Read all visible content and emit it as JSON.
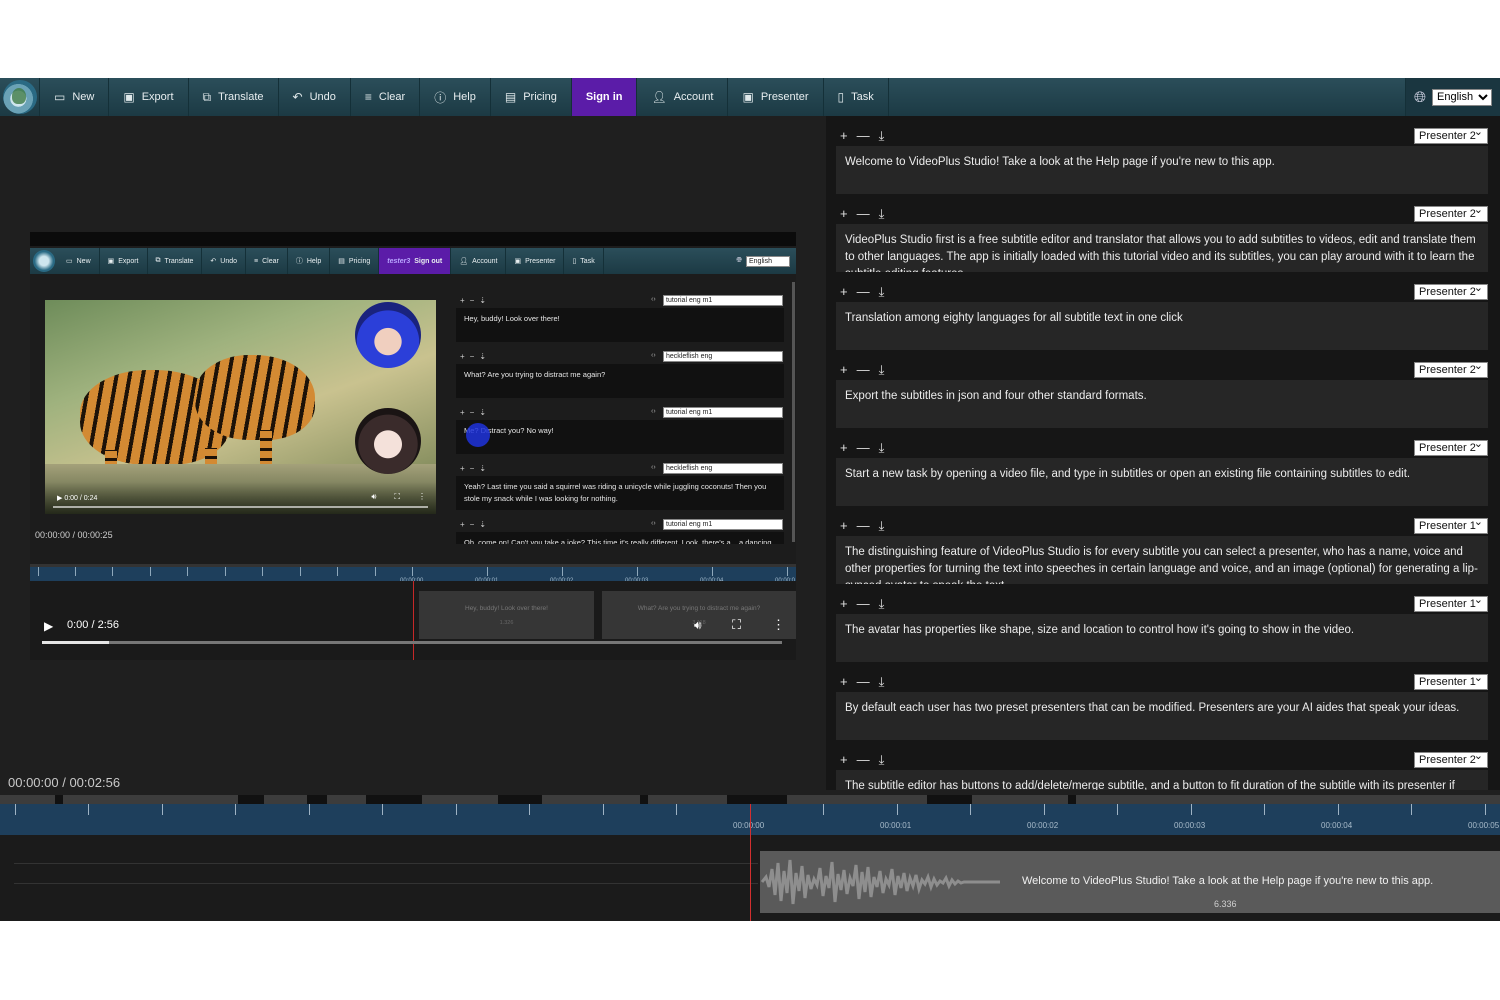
{
  "toolbar": {
    "items": [
      {
        "label": "New",
        "icon": "new-icon"
      },
      {
        "label": "Export",
        "icon": "export-icon"
      },
      {
        "label": "Translate",
        "icon": "translate-icon"
      },
      {
        "label": "Undo",
        "icon": "undo-icon"
      },
      {
        "label": "Clear",
        "icon": "clear-icon"
      },
      {
        "label": "Help",
        "icon": "help-icon"
      },
      {
        "label": "Pricing",
        "icon": "pricing-icon"
      },
      {
        "label": "Sign in",
        "icon": ""
      },
      {
        "label": "Account",
        "icon": "account-icon"
      },
      {
        "label": "Presenter",
        "icon": "presenter-icon"
      },
      {
        "label": "Task",
        "icon": "task-icon"
      }
    ],
    "language": "English",
    "signin_color": "#5b1ca8"
  },
  "preview": {
    "mini_toolbar": [
      "New",
      "Export",
      "Translate",
      "Undo",
      "Clear",
      "Help",
      "Pricing",
      "Sign out",
      "Account",
      "Presenter",
      "Task"
    ],
    "mini_user": "tester3",
    "mini_language": "English",
    "player_time": "0:00 / 0:24",
    "timecode": "00:00:00 / 00:00:25",
    "subtitles": [
      {
        "presenter": "tutorial eng m1",
        "text": "Hey, buddy! Look over there!"
      },
      {
        "presenter": "heckleflish eng",
        "text": "What? Are you trying to distract me again?"
      },
      {
        "presenter": "tutorial eng m1",
        "text": "Me? Distract you? No way!"
      },
      {
        "presenter": "heckleflish eng",
        "text": "Yeah? Last time you said a squirrel was riding a unicycle while juggling coconuts! Then you stole my snack while I was looking for nothing."
      },
      {
        "presenter": "tutorial eng m1",
        "text": "Oh, come on! Can't you take a joke? This time it's really different. Look, there's a... a dancing elephant!"
      }
    ],
    "ruler_labels": [
      "00:00:00",
      "00:00:01",
      "00:00:02",
      "00:00:03",
      "00:00:04",
      "00:00:0"
    ],
    "clips": [
      {
        "text": "Hey, buddy! Look over there!",
        "dur": "1.326"
      },
      {
        "text": "What? Are you trying to distract me again?",
        "dur": "3.118"
      }
    ],
    "main_time": "0:00 / 2:56",
    "main_progress": 0.09
  },
  "timecode": "00:00:00 / 00:02:56",
  "subtitles": [
    {
      "presenter": "Presenter 2",
      "text": "Welcome to VideoPlus Studio! Take a look at the Help page if you're new to this app."
    },
    {
      "presenter": "Presenter 2",
      "text": "VideoPlus Studio first is a free subtitle editor and translator that allows you to add subtitles to videos, edit and translate them to other languages. The app is initially loaded with this tutorial video and its subtitles, you can play around with it to learn the subtitle editing features."
    },
    {
      "presenter": "Presenter 2",
      "text": "Translation among eighty languages for all subtitle text in one click"
    },
    {
      "presenter": "Presenter 2",
      "text": "Export the subtitles in json and four other standard formats."
    },
    {
      "presenter": "Presenter 2",
      "text": "Start a new task by opening a video file, and type in subtitles or open an existing file containing subtitles to edit."
    },
    {
      "presenter": "Presenter 1",
      "text": "The distinguishing feature of VideoPlus Studio is for every subtitle you can select a presenter, who has a name, voice and other properties for turning the text into speeches in certain language and voice, and an image (optional) for generating a lip-synced avatar to speak the text."
    },
    {
      "presenter": "Presenter 1",
      "text": "The avatar has properties like shape, size and location to control how it's going to show in the video."
    },
    {
      "presenter": "Presenter 1",
      "text": "By default each user has two preset presenters that can be modified. Presenters are your AI aides that speak your ideas."
    },
    {
      "presenter": "Presenter 2",
      "text": "The subtitle editor has buttons to add/delete/merge subtitle, and a button to fit duration of the subtitle with its presenter if"
    }
  ],
  "timeline": {
    "labels": [
      "00:00:00",
      "00:00:01",
      "00:00:02",
      "00:00:03",
      "00:00:04",
      "00:00:05"
    ],
    "clip_text": "Welcome to VideoPlus Studio! Take a look at the Help page if you're new to this app.",
    "clip_duration": "6.336"
  }
}
